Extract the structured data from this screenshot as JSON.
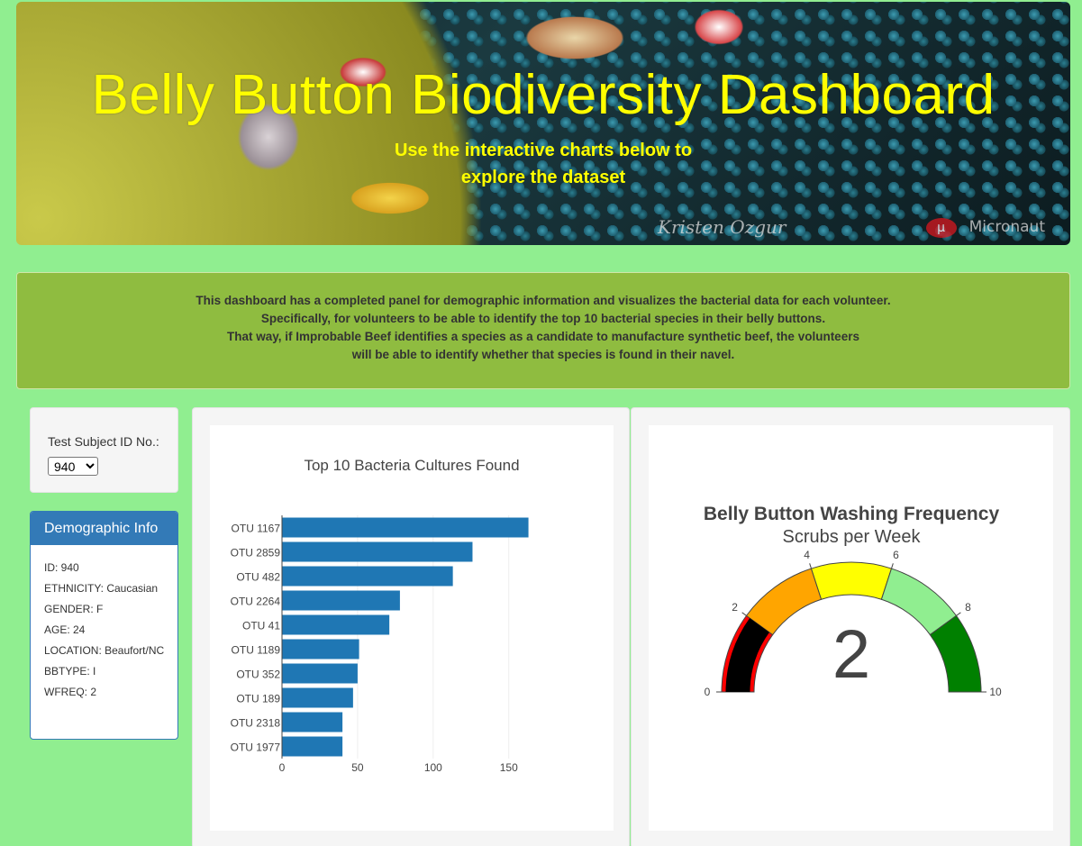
{
  "header": {
    "title": "Belly Button Biodiversity Dashboard",
    "subtitle_line1": "Use the interactive charts below to",
    "subtitle_line2": "explore the dataset",
    "watermark": "Micronaut",
    "signature": "Kristen Ozgur"
  },
  "description": {
    "lines": [
      "This dashboard has a completed panel for demographic information and visualizes the bacterial data for each volunteer.",
      "Specifically, for volunteers to be able to identify the top 10 bacterial species in their belly buttons.",
      "That way, if Improbable Beef identifies a species as a candidate to manufacture synthetic beef, the volunteers",
      "will be able to identify whether that species is found in their navel."
    ]
  },
  "selector": {
    "label": "Test Subject ID No.:",
    "selected": "940",
    "options": [
      "940"
    ]
  },
  "demographic": {
    "heading": "Demographic Info",
    "rows": [
      "ID: 940",
      "ETHNICITY: Caucasian",
      "GENDER: F",
      "AGE: 24",
      "LOCATION: Beaufort/NC",
      "BBTYPE: I",
      "WFREQ: 2"
    ]
  },
  "chart_data": [
    {
      "type": "bar",
      "orientation": "horizontal",
      "title": "Top 10 Bacteria Cultures Found",
      "categories": [
        "OTU 1167",
        "OTU 2859",
        "OTU 482",
        "OTU 2264",
        "OTU 41",
        "OTU 1189",
        "OTU 352",
        "OTU 189",
        "OTU 2318",
        "OTU 1977"
      ],
      "values": [
        163,
        126,
        113,
        78,
        71,
        51,
        50,
        47,
        40,
        40
      ],
      "xticks": [
        0,
        50,
        100,
        150
      ],
      "xlim": [
        0,
        171.6
      ],
      "grid": true,
      "color": "#1f77b4"
    },
    {
      "type": "gauge",
      "title": "Belly Button Washing Frequency",
      "subtitle": "Scrubs per Week",
      "value": 2,
      "range": [
        0,
        10
      ],
      "ticks": [
        0,
        2,
        4,
        6,
        8,
        10
      ],
      "bands": [
        {
          "from": 0,
          "to": 2,
          "color": "#ff0000"
        },
        {
          "from": 2,
          "to": 4,
          "color": "#ffa500"
        },
        {
          "from": 4,
          "to": 6,
          "color": "#ffff00"
        },
        {
          "from": 6,
          "to": 8,
          "color": "#90ee90"
        },
        {
          "from": 8,
          "to": 10,
          "color": "#008000"
        }
      ],
      "bar_color": "#000000"
    }
  ]
}
